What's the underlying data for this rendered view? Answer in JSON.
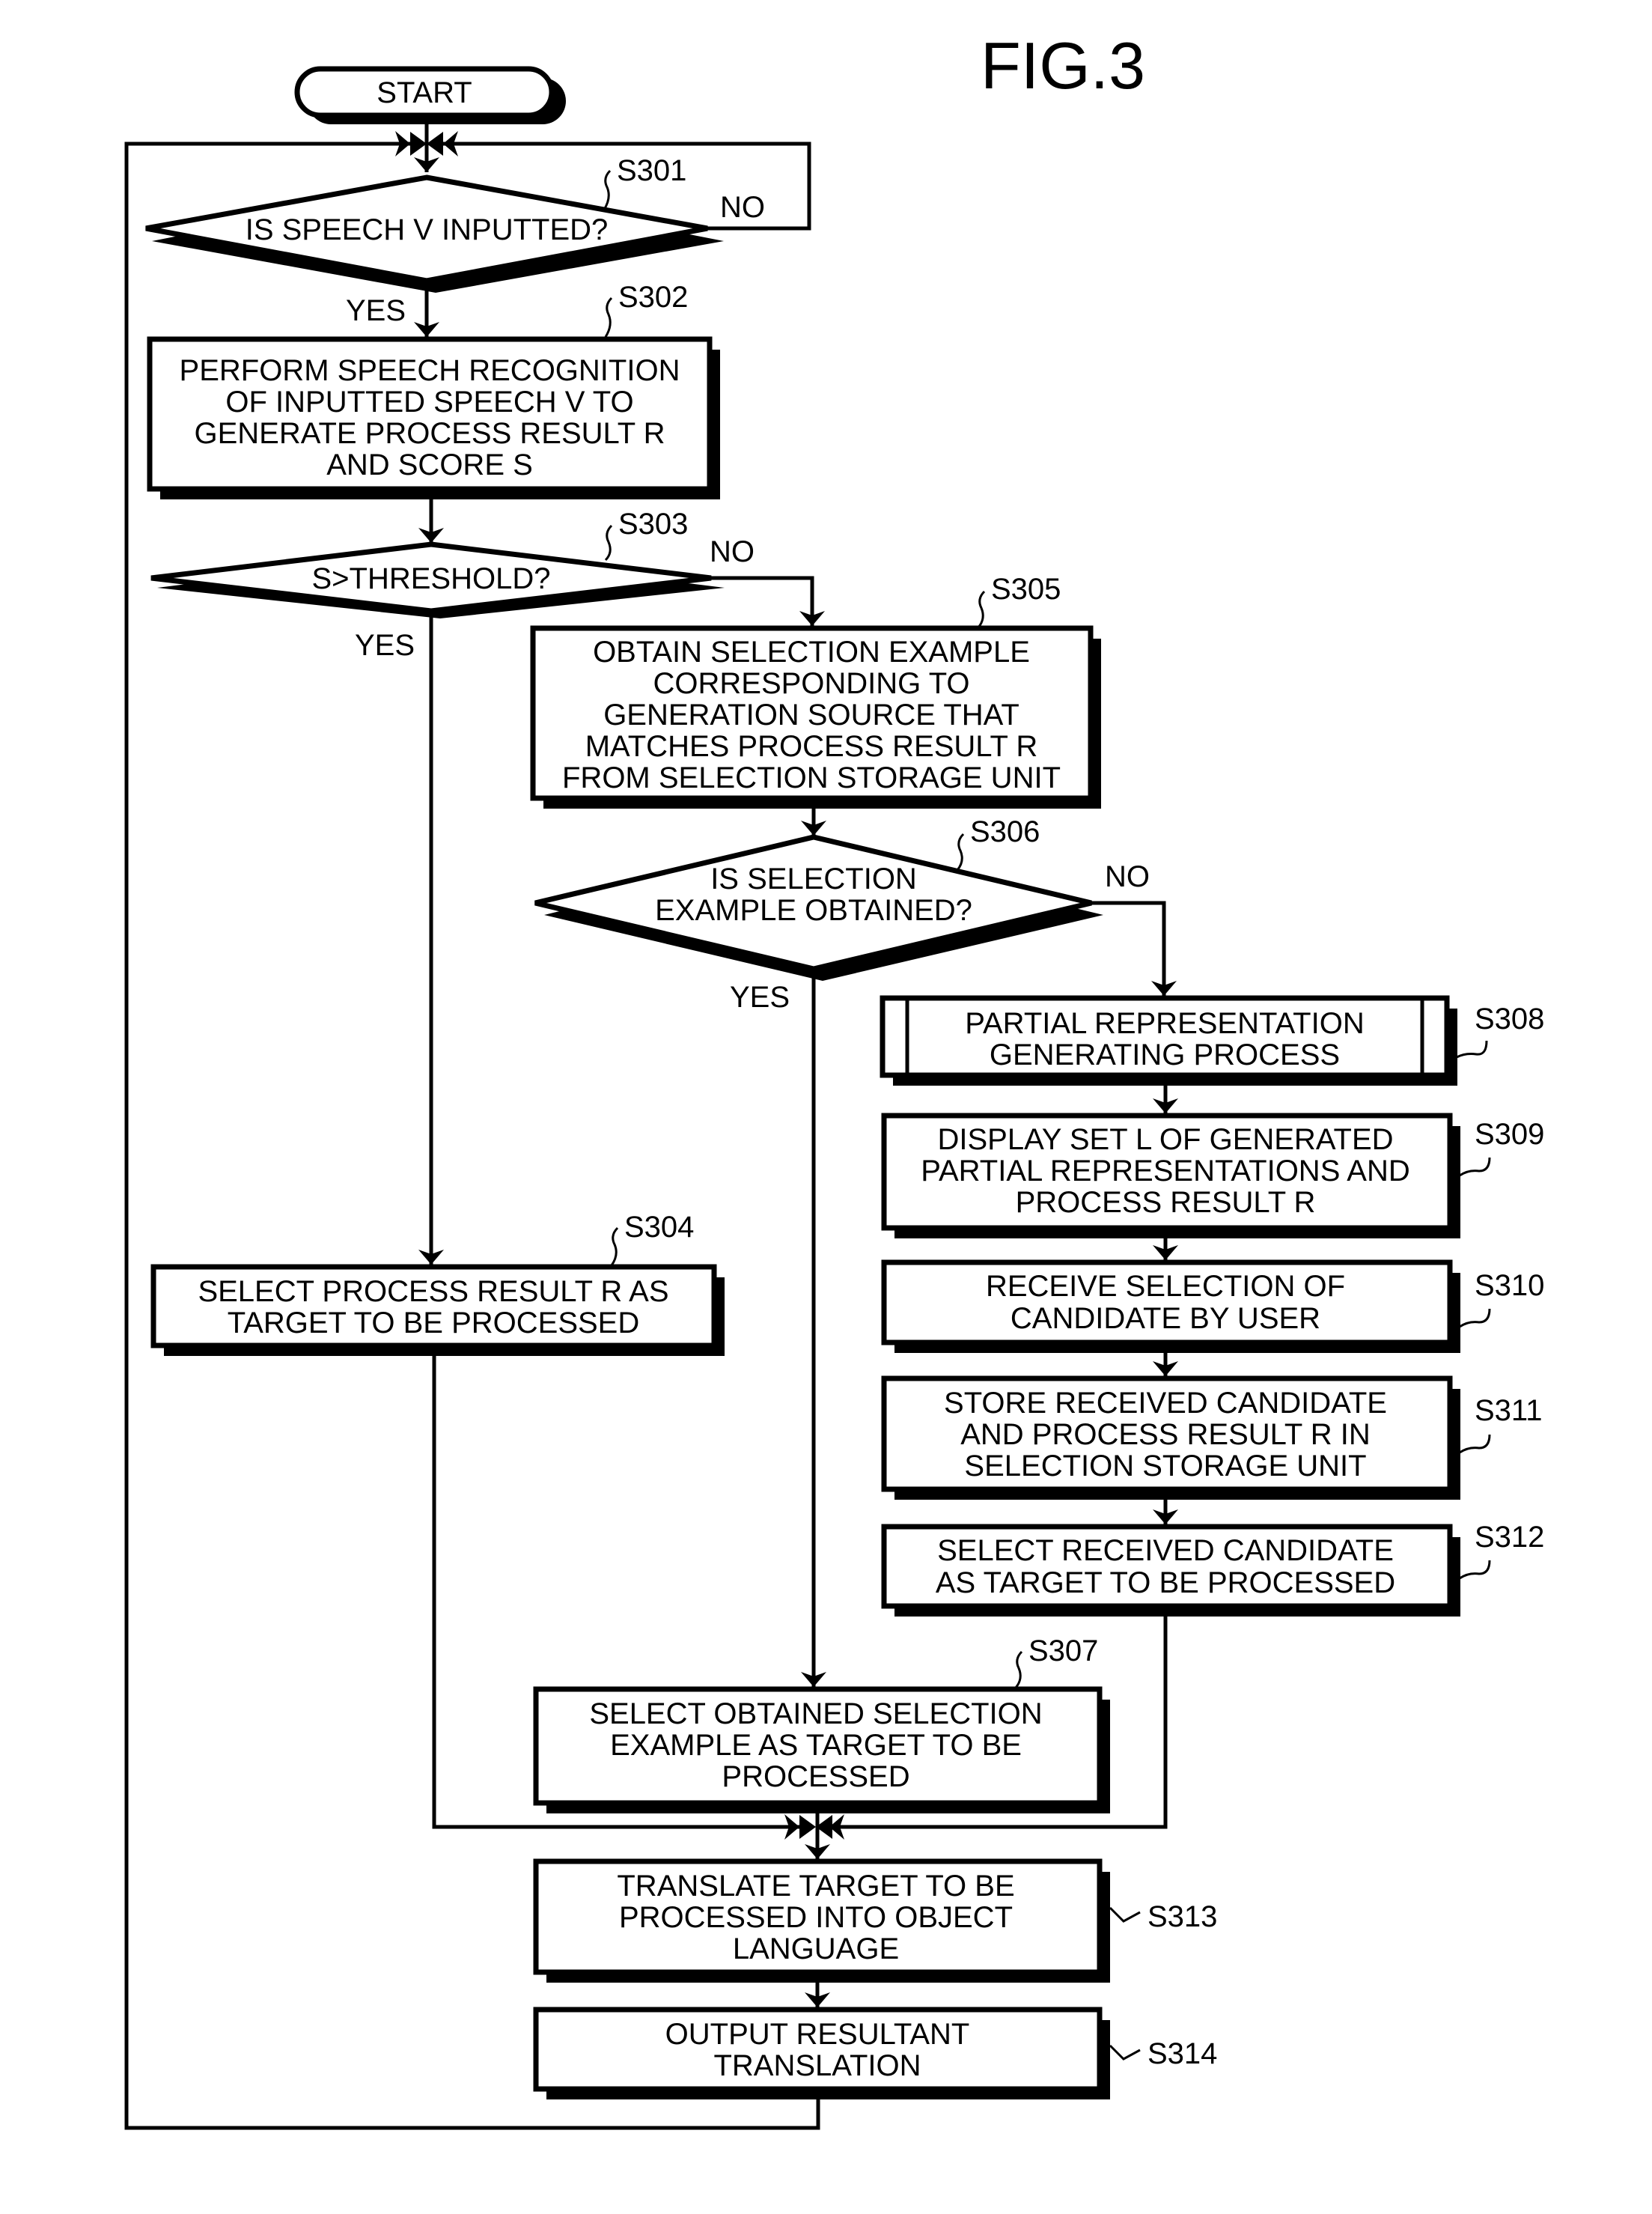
{
  "figure_title": "FIG.3",
  "start": {
    "label": "START"
  },
  "steps": {
    "S301": {
      "id": "S301",
      "type": "decision",
      "lines": [
        "IS SPEECH V INPUTTED?"
      ],
      "yes": "YES",
      "no": "NO"
    },
    "S302": {
      "id": "S302",
      "type": "process",
      "lines": [
        "PERFORM SPEECH RECOGNITION",
        "OF INPUTTED SPEECH V TO",
        "GENERATE PROCESS RESULT R",
        "AND SCORE S"
      ]
    },
    "S303": {
      "id": "S303",
      "type": "decision",
      "lines": [
        "S>THRESHOLD?"
      ],
      "yes": "YES",
      "no": "NO"
    },
    "S304": {
      "id": "S304",
      "type": "process",
      "lines": [
        "SELECT PROCESS RESULT R AS",
        "TARGET TO BE PROCESSED"
      ]
    },
    "S305": {
      "id": "S305",
      "type": "process",
      "lines": [
        "OBTAIN SELECTION EXAMPLE",
        "CORRESPONDING TO",
        "GENERATION SOURCE THAT",
        "MATCHES PROCESS RESULT R",
        "FROM SELECTION STORAGE UNIT"
      ]
    },
    "S306": {
      "id": "S306",
      "type": "decision",
      "lines": [
        "IS SELECTION",
        "EXAMPLE OBTAINED?"
      ],
      "yes": "YES",
      "no": "NO"
    },
    "S307": {
      "id": "S307",
      "type": "process",
      "lines": [
        "SELECT OBTAINED SELECTION",
        "EXAMPLE AS TARGET TO BE",
        "PROCESSED"
      ]
    },
    "S308": {
      "id": "S308",
      "type": "subprocess",
      "lines": [
        "PARTIAL REPRESENTATION",
        "GENERATING PROCESS"
      ]
    },
    "S309": {
      "id": "S309",
      "type": "process",
      "lines": [
        "DISPLAY SET L OF GENERATED",
        "PARTIAL REPRESENTATIONS AND",
        "PROCESS RESULT R"
      ]
    },
    "S310": {
      "id": "S310",
      "type": "process",
      "lines": [
        "RECEIVE SELECTION OF",
        "CANDIDATE BY USER"
      ]
    },
    "S311": {
      "id": "S311",
      "type": "process",
      "lines": [
        "STORE RECEIVED CANDIDATE",
        "AND PROCESS RESULT R IN",
        "SELECTION STORAGE UNIT"
      ]
    },
    "S312": {
      "id": "S312",
      "type": "process",
      "lines": [
        "SELECT RECEIVED CANDIDATE",
        "AS TARGET TO BE PROCESSED"
      ]
    },
    "S313": {
      "id": "S313",
      "type": "process",
      "lines": [
        "TRANSLATE TARGET TO BE",
        "PROCESSED INTO OBJECT",
        "LANGUAGE"
      ]
    },
    "S314": {
      "id": "S314",
      "type": "process",
      "lines": [
        "OUTPUT RESULTANT",
        "TRANSLATION"
      ]
    }
  }
}
